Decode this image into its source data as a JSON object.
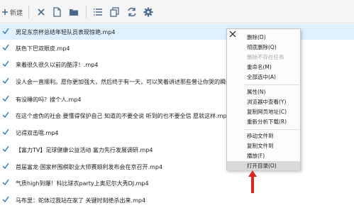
{
  "toolbar": {
    "new_label": "新建"
  },
  "files": [
    "男足东京杯总结年轻队员表现惊艳.mp4",
    "肤色下巴双眼皮.mp4",
    "来着很久很久以前的酷浮！.mp4",
    "没人会一直顺利。愿你更加强大，然后终于有一天，可以笑着讲述那些曾让你哭的瞬间。.mp4",
    "有没睡的吗？搜个人.mp4",
    "在这个虚伪的社会  要懂得保护自己  知道的不要全说  听到的也不要全信    愿就这样.mp4",
    "记得双击哦.mp4",
    "【富力TV】足球健康公益活动  富力先行发展调研.mp4",
    "首届富龙·国家杯围棋职业大师赛顺利发布会在京召开.mp4",
    "气质high到爆！科比球衣party上奥尼尔大秀DJ.mp4",
    "马布里：蛇体过我站在家了  关键时刻绝杀出来.mp4"
  ],
  "context_menu": {
    "group1": [
      "删除(D)",
      "彻底删除(Q)",
      "删除不存在任务",
      "重命名(M)",
      "全部选中(A)"
    ],
    "group2": [
      "属性(N)",
      "浏览器中查看(Y)",
      "复制网页地址(C)",
      "重新分析下载(R)"
    ],
    "group3": [
      "移动文件到",
      "复制文件到",
      "播放(F)",
      "打开目录(O)"
    ],
    "disabled_item": "删除不存在任务",
    "highlighted_item": "打开目录(O)"
  },
  "colors": {
    "check": "#2a7fd4",
    "toolbar_icon": "#4a6a8c",
    "arrow": "#e0221b"
  }
}
